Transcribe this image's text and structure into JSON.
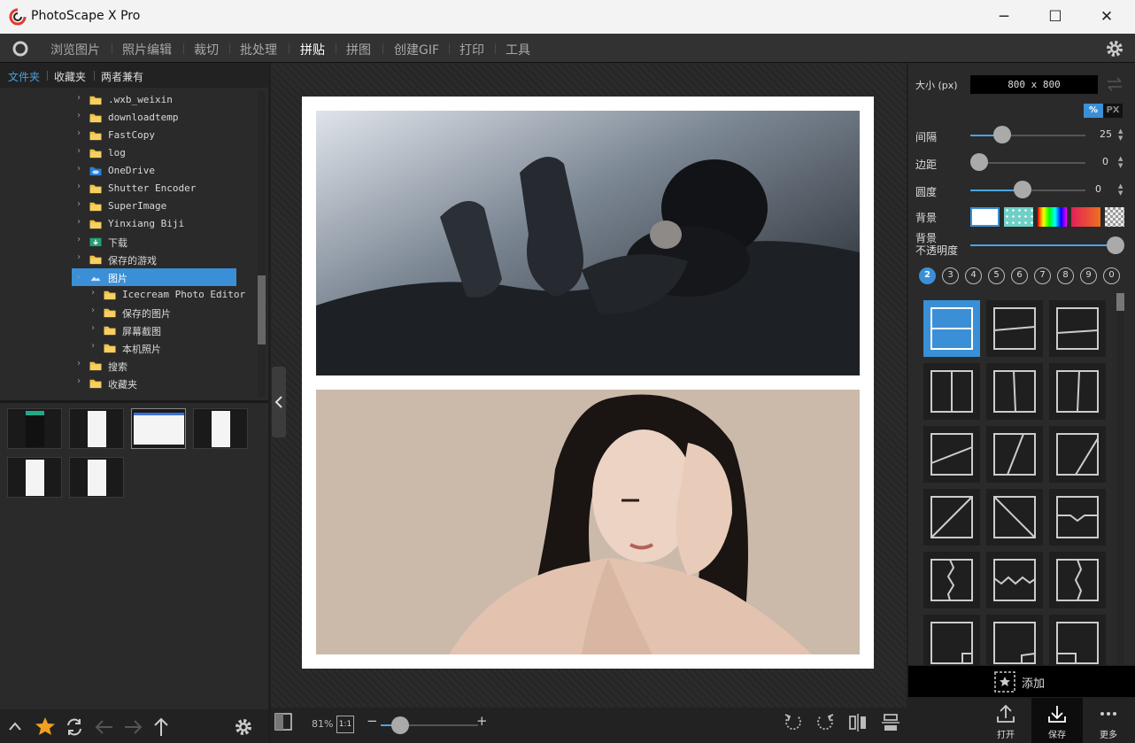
{
  "window": {
    "title": "PhotoScape X Pro",
    "minimize": "─",
    "maximize": "☐",
    "close": "✕"
  },
  "menu": {
    "items": [
      "浏览图片",
      "照片编辑",
      "裁切",
      "批处理",
      "拼贴",
      "拼图",
      "创建GIF",
      "打印",
      "工具"
    ],
    "active": "拼贴"
  },
  "left_tabs": [
    "文件夹",
    "收藏夹",
    "两者兼有"
  ],
  "tree": [
    {
      "label": ".wxb_weixin",
      "level": 0,
      "icon": "folder-icon"
    },
    {
      "label": "downloadtemp",
      "level": 0,
      "icon": "folder-icon"
    },
    {
      "label": "FastCopy",
      "level": 0,
      "icon": "folder-icon"
    },
    {
      "label": "log",
      "level": 0,
      "icon": "folder-icon"
    },
    {
      "label": "OneDrive",
      "level": 0,
      "icon": "cloud-folder-icon"
    },
    {
      "label": "Shutter Encoder",
      "level": 0,
      "icon": "folder-icon"
    },
    {
      "label": "SuperImage",
      "level": 0,
      "icon": "folder-icon"
    },
    {
      "label": "Yinxiang Biji",
      "level": 0,
      "icon": "folder-icon"
    },
    {
      "label": "下载",
      "level": 0,
      "icon": "download-folder-icon"
    },
    {
      "label": "保存的游戏",
      "level": 0,
      "icon": "folder-icon"
    },
    {
      "label": "图片",
      "level": 0,
      "icon": "pictures-folder-icon",
      "selected": true,
      "expanded": true
    },
    {
      "label": "Icecream Photo Editor",
      "level": 1,
      "icon": "folder-icon"
    },
    {
      "label": "保存的图片",
      "level": 1,
      "icon": "folder-icon"
    },
    {
      "label": "屏幕截图",
      "level": 1,
      "icon": "folder-icon"
    },
    {
      "label": "本机照片",
      "level": 1,
      "icon": "folder-icon"
    },
    {
      "label": "搜索",
      "level": 0,
      "icon": "folder-icon"
    },
    {
      "label": "收藏夹",
      "level": 0,
      "icon": "folder-icon"
    }
  ],
  "status": {
    "zoom": "81%",
    "one_to_one": "1:1",
    "minus": "−",
    "plus": "+",
    "zoom_fraction": 0.2
  },
  "right": {
    "size_label": "大小 (px)",
    "size_value": "800 x 800",
    "unit_percent": "%",
    "unit_px": "PX",
    "spacing_label": "间隔",
    "spacing_value": "25",
    "margin_label": "边距",
    "margin_value": "0",
    "round_label": "圆度",
    "round_value": "0",
    "bg_label": "背景",
    "bg_opacity_label_1": "背景",
    "bg_opacity_label_2": "不透明度",
    "counts": [
      "2",
      "3",
      "4",
      "5",
      "6",
      "7",
      "8",
      "9",
      "0"
    ],
    "active_count": "2",
    "add_label": "添加"
  },
  "right_bottom": {
    "open": "打开",
    "save": "保存",
    "more": "更多"
  },
  "colors": {
    "accent": "#3a8fd6",
    "folder": "#f0c040"
  }
}
